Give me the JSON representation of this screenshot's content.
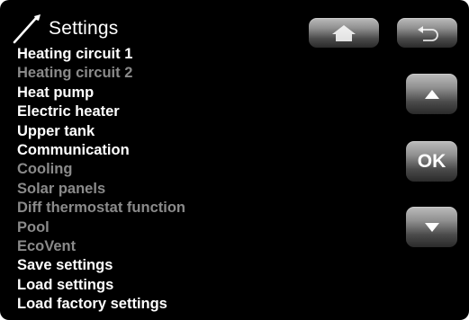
{
  "header": {
    "title": "Settings",
    "icon": "wrench-icon"
  },
  "menu": {
    "items": [
      {
        "label": "Heating circuit 1",
        "enabled": true
      },
      {
        "label": "Heating circuit 2",
        "enabled": false
      },
      {
        "label": "Heat pump",
        "enabled": true
      },
      {
        "label": "Electric heater",
        "enabled": true
      },
      {
        "label": "Upper tank",
        "enabled": true
      },
      {
        "label": "Communication",
        "enabled": true
      },
      {
        "label": "Cooling",
        "enabled": false
      },
      {
        "label": "Solar panels",
        "enabled": false
      },
      {
        "label": "Diff thermostat function",
        "enabled": false
      },
      {
        "label": "Pool",
        "enabled": false
      },
      {
        "label": "EcoVent",
        "enabled": false
      },
      {
        "label": "Save settings",
        "enabled": true
      },
      {
        "label": "Load settings",
        "enabled": true
      },
      {
        "label": "Load factory settings",
        "enabled": true
      }
    ]
  },
  "buttons": {
    "home_icon": "home-icon",
    "back_icon": "back-arrow-icon",
    "up_icon": "up-arrow-icon",
    "ok_label": "OK",
    "down_icon": "down-arrow-icon"
  },
  "colors": {
    "background": "#000000",
    "enabled_text": "#ffffff",
    "disabled_text": "#8a8a8a"
  }
}
